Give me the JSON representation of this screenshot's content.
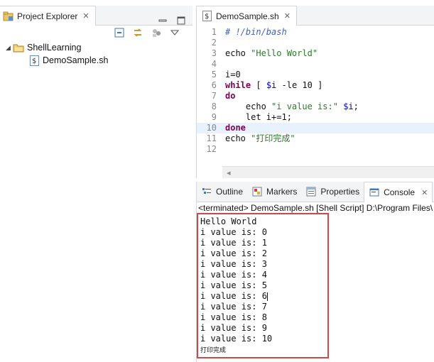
{
  "explorer": {
    "title": "Project Explorer",
    "close_glyph": "✕",
    "tree": [
      {
        "label": "ShellLearning",
        "type": "project",
        "expanded": true
      },
      {
        "label": "DemoSample.sh",
        "type": "shell-file"
      }
    ]
  },
  "editor": {
    "tab_title": "DemoSample.sh",
    "close_glyph": "✕",
    "current_line": 10,
    "line_numbers": [
      "1",
      "2",
      "3",
      "4",
      "5",
      "6",
      "7",
      "8",
      "9",
      "10",
      "11",
      "12"
    ],
    "lines": [
      "# !/bin/bash",
      "",
      "echo \"Hello World\"",
      "",
      "i=0",
      "while [ $i -le 10 ]",
      "do",
      "    echo \"i value is:\" $i;",
      "    let i+=1;",
      "done",
      "echo \"打印完成\"",
      ""
    ],
    "scroll_glyph": "◂"
  },
  "panel": {
    "tabs": [
      {
        "label": "Outline"
      },
      {
        "label": "Markers"
      },
      {
        "label": "Properties"
      },
      {
        "label": "Console",
        "active": true
      }
    ],
    "close_glyph": "✕",
    "status": "<terminated> DemoSample.sh [Shell Script] D:\\Program Files\\",
    "output": [
      "Hello World",
      "i value is: 0",
      "i value is: 1",
      "i value is: 2",
      "i value is: 3",
      "i value is: 4",
      "i value is: 5",
      "i value is: 6",
      "i value is: 7",
      "i value is: 8",
      "i value is: 9",
      "i value is: 10",
      "打印完成"
    ]
  },
  "colors": {
    "highlight_border": "#c94a4a",
    "keyword": "#7f0055",
    "string": "#2a7a2a",
    "comment": "#3f5fbf"
  }
}
